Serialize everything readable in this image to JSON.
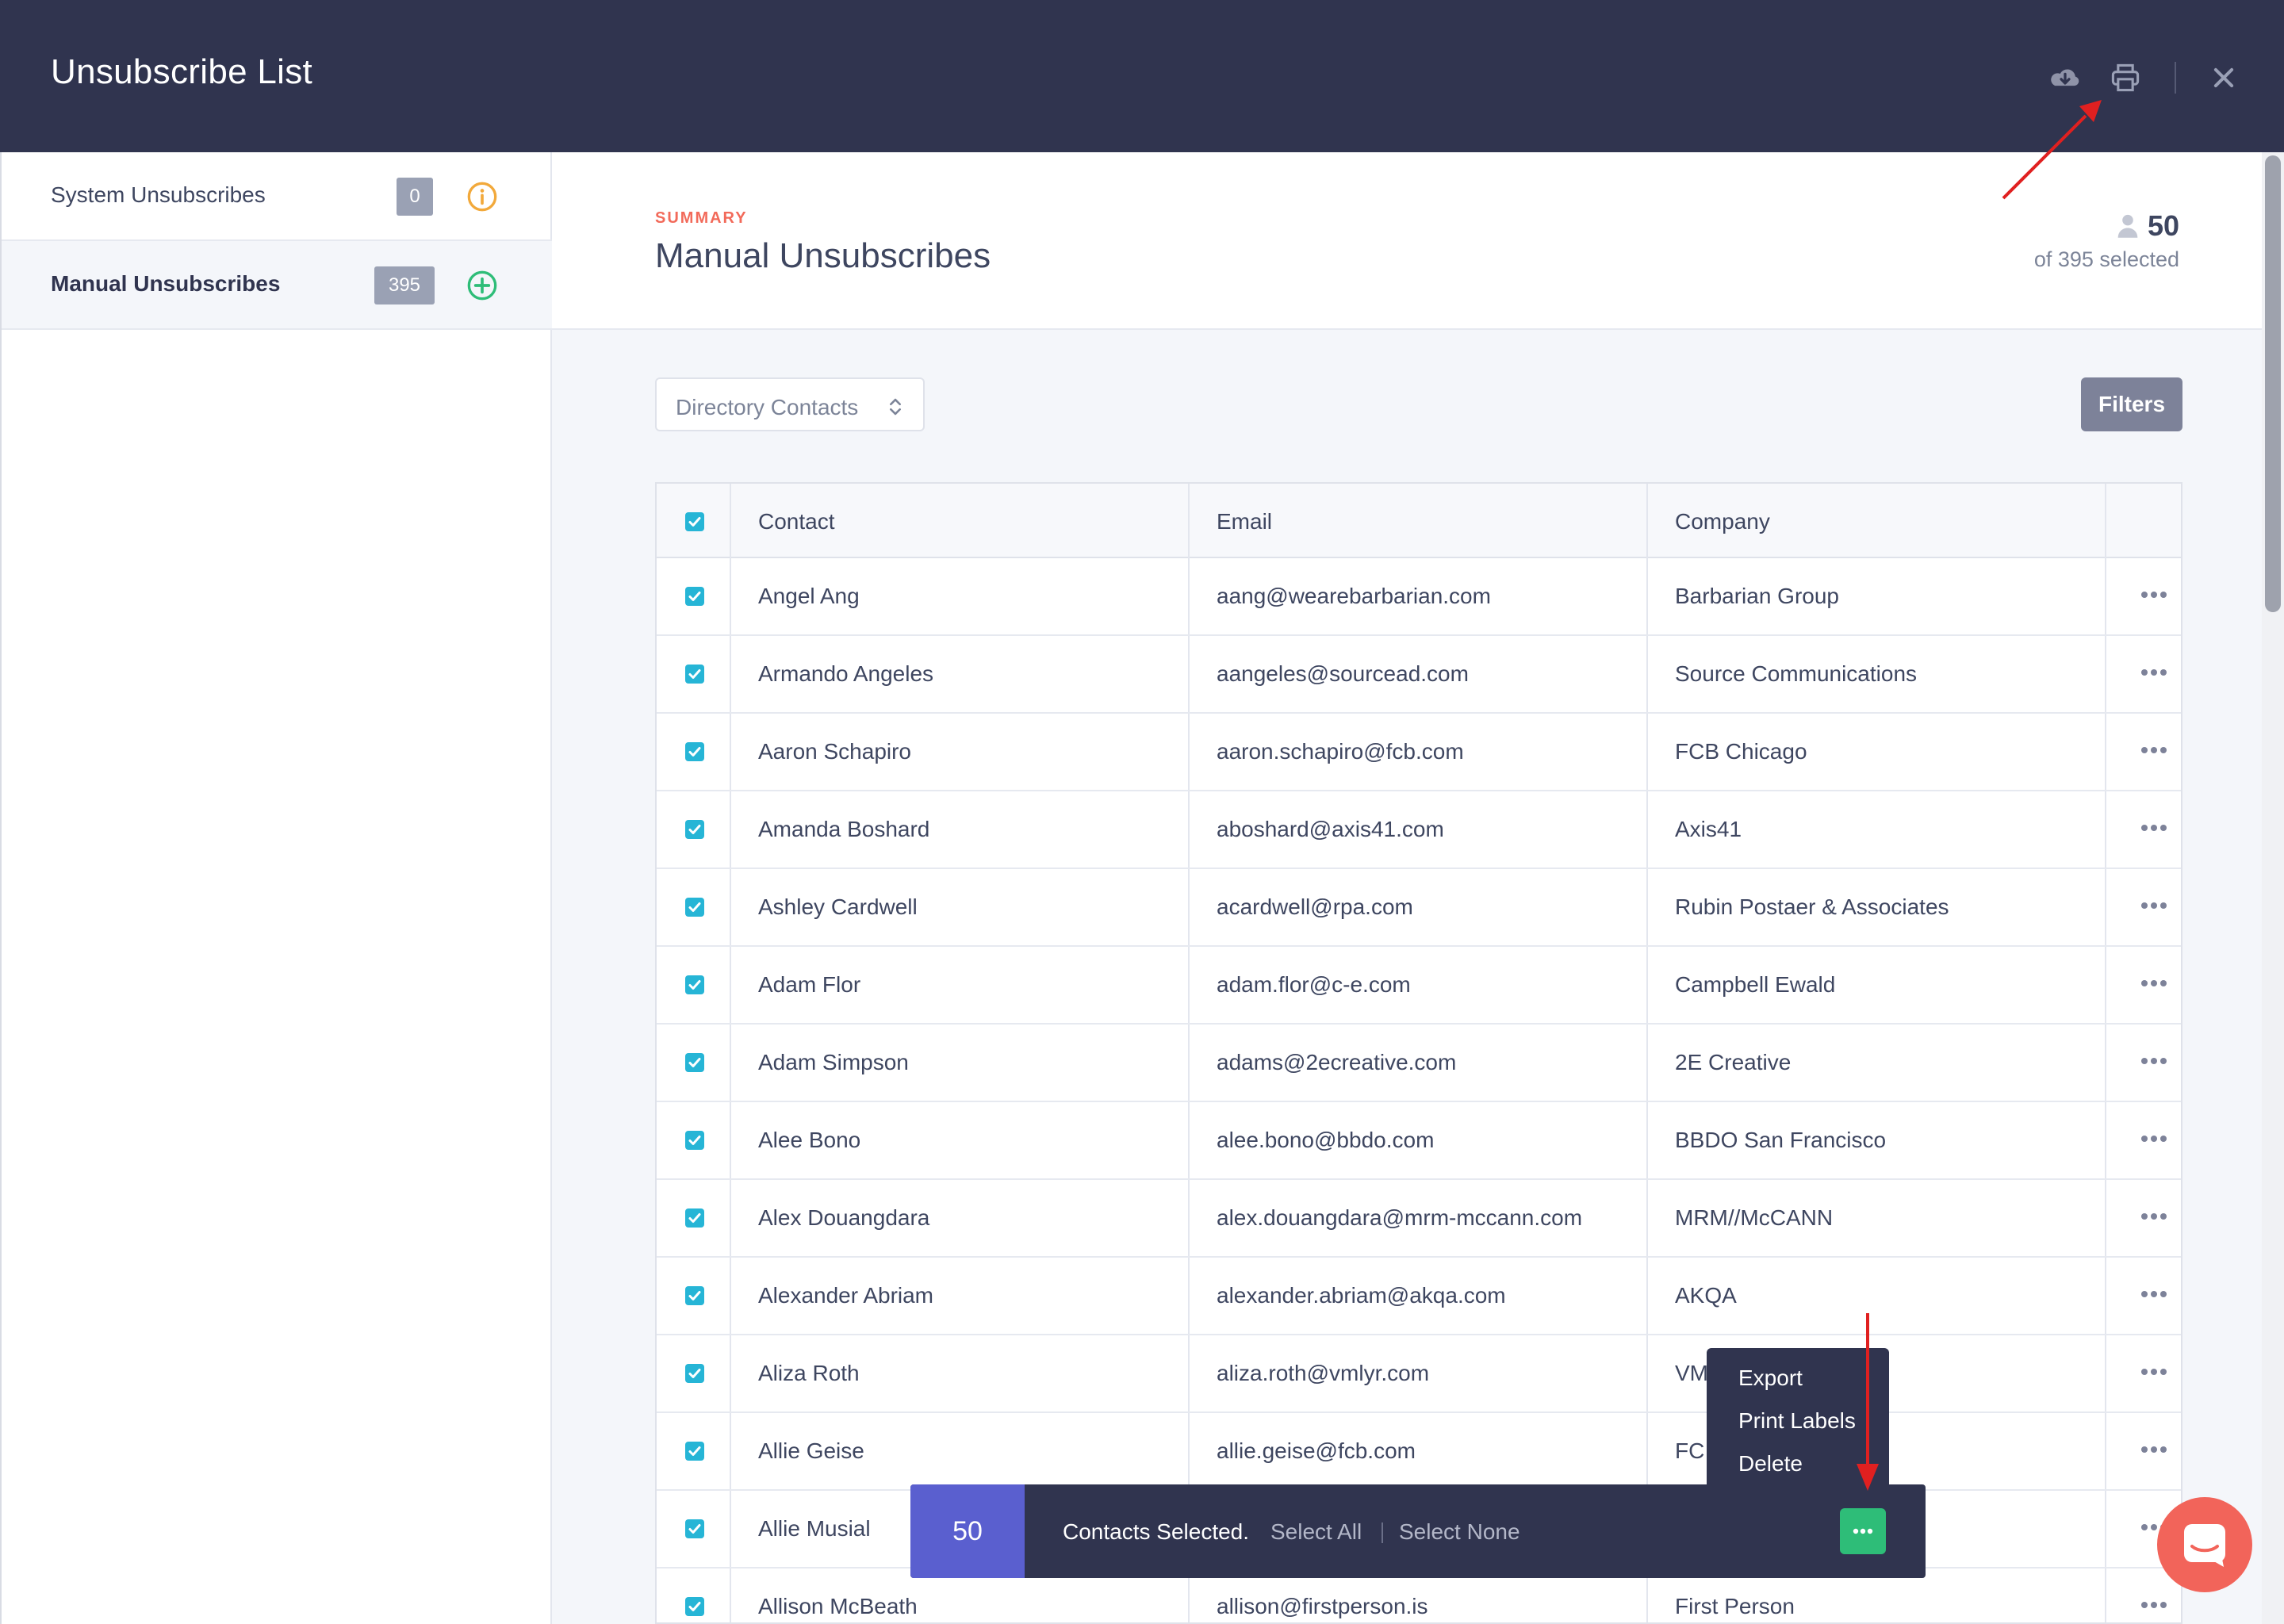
{
  "header": {
    "title": "Unsubscribe List"
  },
  "sidebar": {
    "items": [
      {
        "label": "System Unsubscribes",
        "count": "0"
      },
      {
        "label": "Manual Unsubscribes",
        "count": "395"
      }
    ]
  },
  "summary": {
    "eyebrow": "SUMMARY",
    "title": "Manual Unsubscribes",
    "selected_count": "50",
    "selected_sub": "of 395 selected"
  },
  "toolbar": {
    "directory_select": "Directory Contacts",
    "filters_label": "Filters"
  },
  "table": {
    "headers": [
      "Contact",
      "Email",
      "Company"
    ],
    "rows": [
      {
        "contact": "Angel Ang",
        "email": "aang@wearebarbarian.com",
        "company": "Barbarian Group"
      },
      {
        "contact": "Armando Angeles",
        "email": "aangeles@sourcead.com",
        "company": "Source Communications"
      },
      {
        "contact": "Aaron Schapiro",
        "email": "aaron.schapiro@fcb.com",
        "company": "FCB Chicago"
      },
      {
        "contact": "Amanda Boshard",
        "email": "aboshard@axis41.com",
        "company": "Axis41"
      },
      {
        "contact": "Ashley Cardwell",
        "email": "acardwell@rpa.com",
        "company": "Rubin Postaer & Associates"
      },
      {
        "contact": "Adam Flor",
        "email": "adam.flor@c-e.com",
        "company": "Campbell Ewald"
      },
      {
        "contact": "Adam Simpson",
        "email": "adams@2ecreative.com",
        "company": "2E Creative"
      },
      {
        "contact": "Alee Bono",
        "email": "alee.bono@bbdo.com",
        "company": "BBDO San Francisco"
      },
      {
        "contact": "Alex Douangdara",
        "email": "alex.douangdara@mrm-mccann.com",
        "company": "MRM//McCANN"
      },
      {
        "contact": "Alexander Abriam",
        "email": "alexander.abriam@akqa.com",
        "company": "AKQA"
      },
      {
        "contact": "Aliza Roth",
        "email": "aliza.roth@vmlyr.com",
        "company": "VM"
      },
      {
        "contact": "Allie Geise",
        "email": "allie.geise@fcb.com",
        "company": "FC"
      },
      {
        "contact": "Allie Musial",
        "email": "",
        "company": ""
      },
      {
        "contact": "Allison McBeath",
        "email": "allison@firstperson.is",
        "company": "First Person"
      }
    ]
  },
  "bulk_bar": {
    "count": "50",
    "text": "Contacts Selected.",
    "select_all": "Select All",
    "select_none": "Select None"
  },
  "actions_menu": {
    "items": [
      "Export",
      "Print Labels",
      "Delete"
    ]
  },
  "colors": {
    "header_bg": "#30344f",
    "accent_checkbox": "#26b5d6",
    "count_badge": "#5a5fcf",
    "more_button": "#2ebd78",
    "eyebrow": "#f26a5a",
    "annotation_arrow": "#e02020"
  }
}
